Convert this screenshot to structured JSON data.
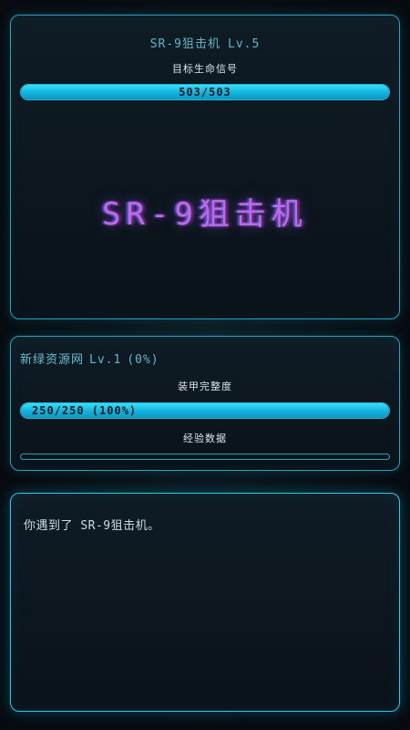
{
  "enemy": {
    "name": "SR-9狙击机",
    "level_label": "Lv.5",
    "hp_label": "目标生命信号",
    "hp_text": "503/503",
    "hp_fraction": 1.0,
    "display_name": "SR-9狙击机"
  },
  "player": {
    "name": "新绿资源网",
    "level_label": "Lv.1",
    "xp_percent_label": "(0%)",
    "armor_label": "装甲完整度",
    "armor_text": "250/250 (100%)",
    "armor_fraction": 1.0,
    "xp_label": "经验数据",
    "xp_fraction": 0.0
  },
  "log": {
    "message": "你遇到了 SR-9狙击机。"
  },
  "colors": {
    "accent": "#1fb8da",
    "bar_fill": "#12b3dc",
    "enemy_glow": "#b86bf0"
  }
}
